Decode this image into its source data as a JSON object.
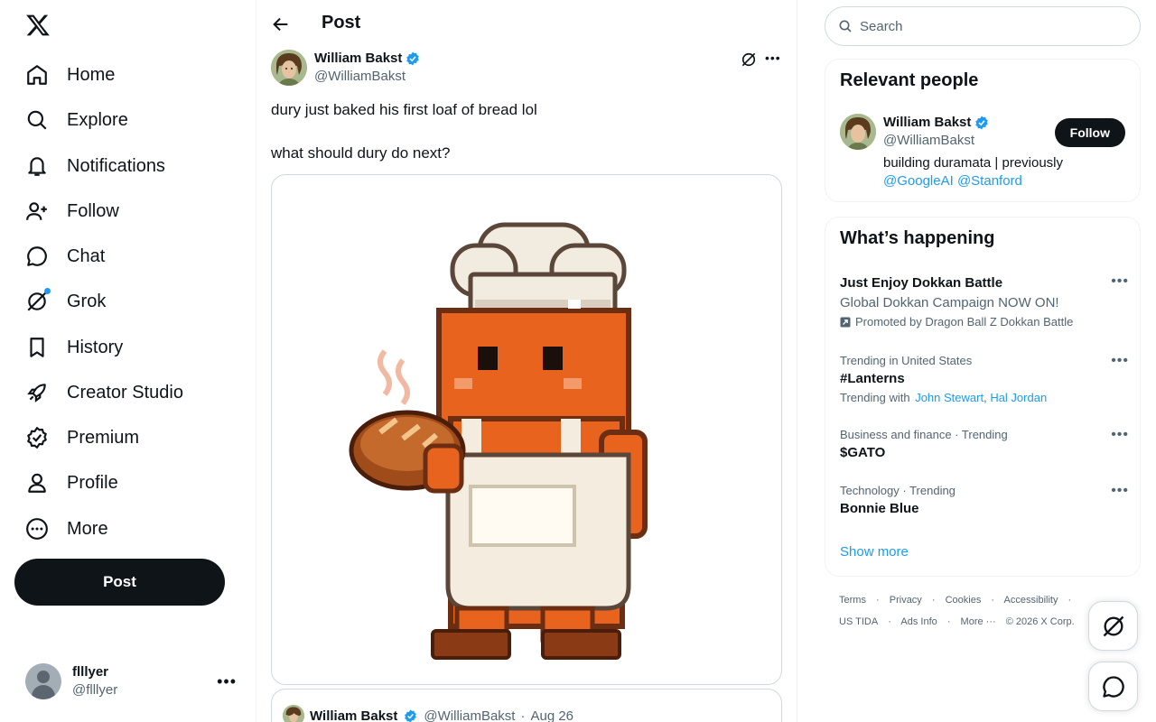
{
  "nav": {
    "items": [
      {
        "label": "Home",
        "icon": "home-icon"
      },
      {
        "label": "Explore",
        "icon": "search-icon"
      },
      {
        "label": "Notifications",
        "icon": "bell-icon"
      },
      {
        "label": "Follow",
        "icon": "person-plus-icon"
      },
      {
        "label": "Chat",
        "icon": "chat-bubble-icon"
      },
      {
        "label": "Grok",
        "icon": "grok-icon"
      },
      {
        "label": "History",
        "icon": "bookmark-icon"
      },
      {
        "label": "Creator Studio",
        "icon": "rocket-icon"
      },
      {
        "label": "Premium",
        "icon": "verified-badge-icon"
      },
      {
        "label": "Profile",
        "icon": "person-icon"
      },
      {
        "label": "More",
        "icon": "more-circle-icon"
      }
    ],
    "post_label": "Post"
  },
  "account": {
    "name": "flllyer",
    "handle": "@flllyer"
  },
  "header": {
    "title": "Post"
  },
  "post": {
    "author_name": "William Bakst",
    "author_handle": "@WilliamBakst",
    "text_line1": "dury just baked his first loaf of bread lol",
    "text_line2": "what should dury do next?",
    "quote": {
      "author_name": "William Bakst",
      "author_handle": "@WilliamBakst",
      "separator": "·",
      "date": "Aug 26"
    }
  },
  "search": {
    "placeholder": "Search"
  },
  "relevant": {
    "title": "Relevant people",
    "name": "William Bakst",
    "handle": "@WilliamBakst",
    "bio": "building duramata | previously",
    "bio_link1": "@GoogleAI",
    "bio_link2": "@Stanford",
    "follow_label": "Follow"
  },
  "happening": {
    "title": "What’s happening",
    "trends": [
      {
        "name": "Just Enjoy Dokkan Battle",
        "sub": "Global Dokkan Campaign NOW ON!",
        "promoted": "Promoted by Dragon Ball Z Dokkan Battle"
      },
      {
        "meta": "Trending in United States",
        "name": "#Lanterns",
        "with_label": "Trending with",
        "with1": "John Stewart",
        "with_sep": ",",
        "with2": "Hal Jordan"
      },
      {
        "meta": "Business and finance · Trending",
        "name": "$GATO"
      },
      {
        "meta": "Technology · Trending",
        "name": "Bonnie Blue"
      }
    ],
    "show_more": "Show more"
  },
  "footer": {
    "row1": [
      "Terms",
      "·",
      "Privacy",
      "·",
      "Cookies",
      "·",
      "Accessibility",
      "·"
    ],
    "row2": [
      "US TIDA",
      "·",
      "Ads Info",
      "·",
      "More ···",
      "© 2026 X Corp."
    ]
  },
  "colors": {
    "accent": "#1d9bf0",
    "text": "#0f1419",
    "muted": "#536471",
    "border": "#cfd9de"
  }
}
